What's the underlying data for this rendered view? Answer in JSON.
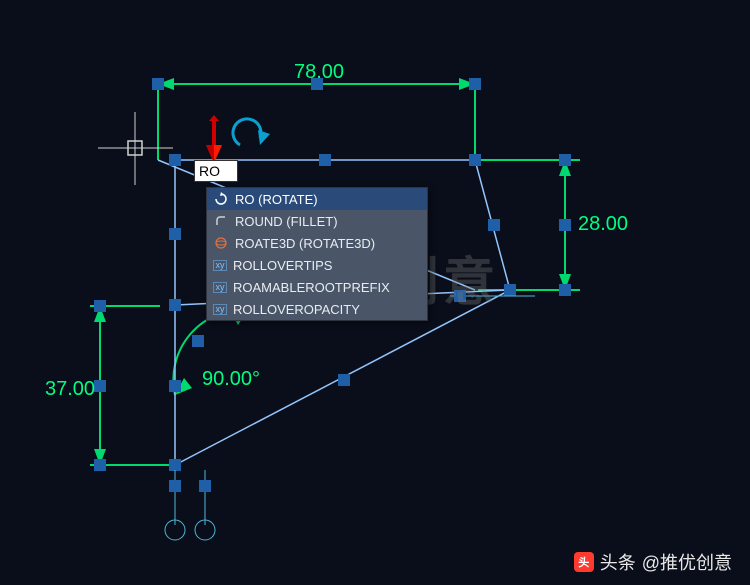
{
  "command_input": "RO",
  "autocomplete": {
    "items": [
      {
        "label": "RO (ROTATE)",
        "icon": "rotate-arc",
        "selected": true
      },
      {
        "label": "ROUND (FILLET)",
        "icon": "fillet-arc",
        "selected": false
      },
      {
        "label": "ROATE3D (ROTATE3D)",
        "icon": "rotate3d",
        "selected": false
      },
      {
        "label": "ROLLOVERTIPS",
        "icon": "variable",
        "selected": false
      },
      {
        "label": "ROAMABLEROOTPREFIX",
        "icon": "variable",
        "selected": false
      },
      {
        "label": "ROLLOVEROPACITY",
        "icon": "variable",
        "selected": false
      }
    ]
  },
  "dimensions": {
    "top": "78.00",
    "right": "28.00",
    "left": "37.00",
    "angle": "90.00°"
  },
  "watermark": "推优创意",
  "attribution": {
    "prefix": "头条",
    "handle": "@推优创意"
  },
  "colors": {
    "bg": "#0a0e1a",
    "dim": "#00d96f",
    "shape": "#3b82f6",
    "grip": "#1e5fa8"
  }
}
